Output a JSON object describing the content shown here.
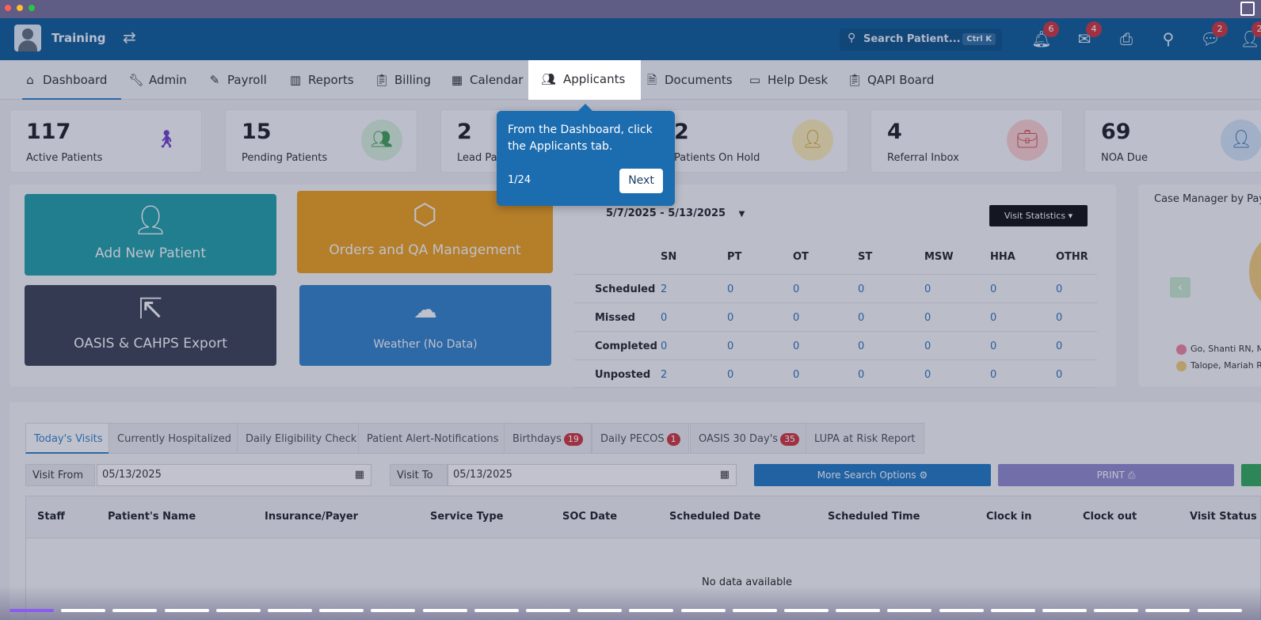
{
  "window": {
    "dots": [
      "#ff5f57",
      "#febc2e",
      "#28c840"
    ]
  },
  "topbar": {
    "brand": "Training",
    "search_placeholder": "Search Patient...",
    "search_shortcut": "Ctrl K",
    "badges": {
      "notifications": "6",
      "mail": "4",
      "chat": "2",
      "user": "2"
    }
  },
  "nav": [
    {
      "label": "Dashboard",
      "icon": "home-icon"
    },
    {
      "label": "Admin",
      "icon": "wrench-icon"
    },
    {
      "label": "Payroll",
      "icon": "edit-icon"
    },
    {
      "label": "Reports",
      "icon": "bar-chart-icon"
    },
    {
      "label": "Billing",
      "icon": "clipboard-icon"
    },
    {
      "label": "Calendar",
      "icon": "calendar-icon"
    },
    {
      "label": "Applicants",
      "icon": "people-icon"
    },
    {
      "label": "Documents",
      "icon": "document-icon"
    },
    {
      "label": "Help Desk",
      "icon": "ticket-icon"
    },
    {
      "label": "QAPI Board",
      "icon": "board-icon"
    }
  ],
  "stats": [
    {
      "num": "117",
      "label": "Active Patients"
    },
    {
      "num": "15",
      "label": "Pending Patients"
    },
    {
      "num": "2",
      "label": "Lead Pat"
    },
    {
      "num": "2",
      "label": "Patients On Hold"
    },
    {
      "num": "4",
      "label": "Referral Inbox"
    },
    {
      "num": "69",
      "label": "NOA Due"
    }
  ],
  "tiles": {
    "add_patient": "Add New Patient",
    "orders": "Orders and QA Management",
    "oasis": "OASIS & CAHPS Export",
    "weather": "Weather (No Data)"
  },
  "visits": {
    "date_range": "5/7/2025 - 5/13/2025",
    "stats_button": "Visit Statistics",
    "columns": [
      "SN",
      "PT",
      "OT",
      "ST",
      "MSW",
      "HHA",
      "OTHR"
    ],
    "rows": [
      {
        "label": "Scheduled",
        "values": [
          "2",
          "0",
          "0",
          "0",
          "0",
          "0",
          "0"
        ]
      },
      {
        "label": "Missed",
        "values": [
          "0",
          "0",
          "0",
          "0",
          "0",
          "0",
          "0"
        ]
      },
      {
        "label": "Completed",
        "values": [
          "0",
          "0",
          "0",
          "0",
          "0",
          "0",
          "0"
        ]
      },
      {
        "label": "Unposted",
        "values": [
          "2",
          "0",
          "0",
          "0",
          "0",
          "0",
          "0"
        ]
      }
    ]
  },
  "case_manager": {
    "title": "Case Manager by Pay",
    "legend": [
      "Go, Shanti RN, M",
      "Talope, Mariah R"
    ]
  },
  "tabs": [
    {
      "label": "Today's Visits",
      "badge": ""
    },
    {
      "label": "Currently Hospitalized",
      "badge": ""
    },
    {
      "label": "Daily Eligibility Check",
      "badge": ""
    },
    {
      "label": "Patient Alert-Notifications",
      "badge": ""
    },
    {
      "label": "Birthdays",
      "badge": "19"
    },
    {
      "label": "Daily PECOS",
      "badge": "1"
    },
    {
      "label": "OASIS 30 Day's",
      "badge": "35"
    },
    {
      "label": "LUPA at Risk Report",
      "badge": ""
    }
  ],
  "filters": {
    "from_label": "Visit From",
    "from_value": "05/13/2025",
    "to_label": "Visit To",
    "to_value": "05/13/2025",
    "more_options": "More Search Options",
    "print": "PRINT"
  },
  "table": {
    "headers": [
      "Staff",
      "Patient's Name",
      "Insurance/Payer",
      "Service Type",
      "SOC Date",
      "Scheduled Date",
      "Scheduled Time",
      "Clock in",
      "Clock out",
      "Visit Status"
    ],
    "empty": "No data available"
  },
  "tour": {
    "text": "From the Dashboard, click the Applicants tab.",
    "step": "1/24",
    "next": "Next",
    "total_steps": 24,
    "current_step": 1
  }
}
